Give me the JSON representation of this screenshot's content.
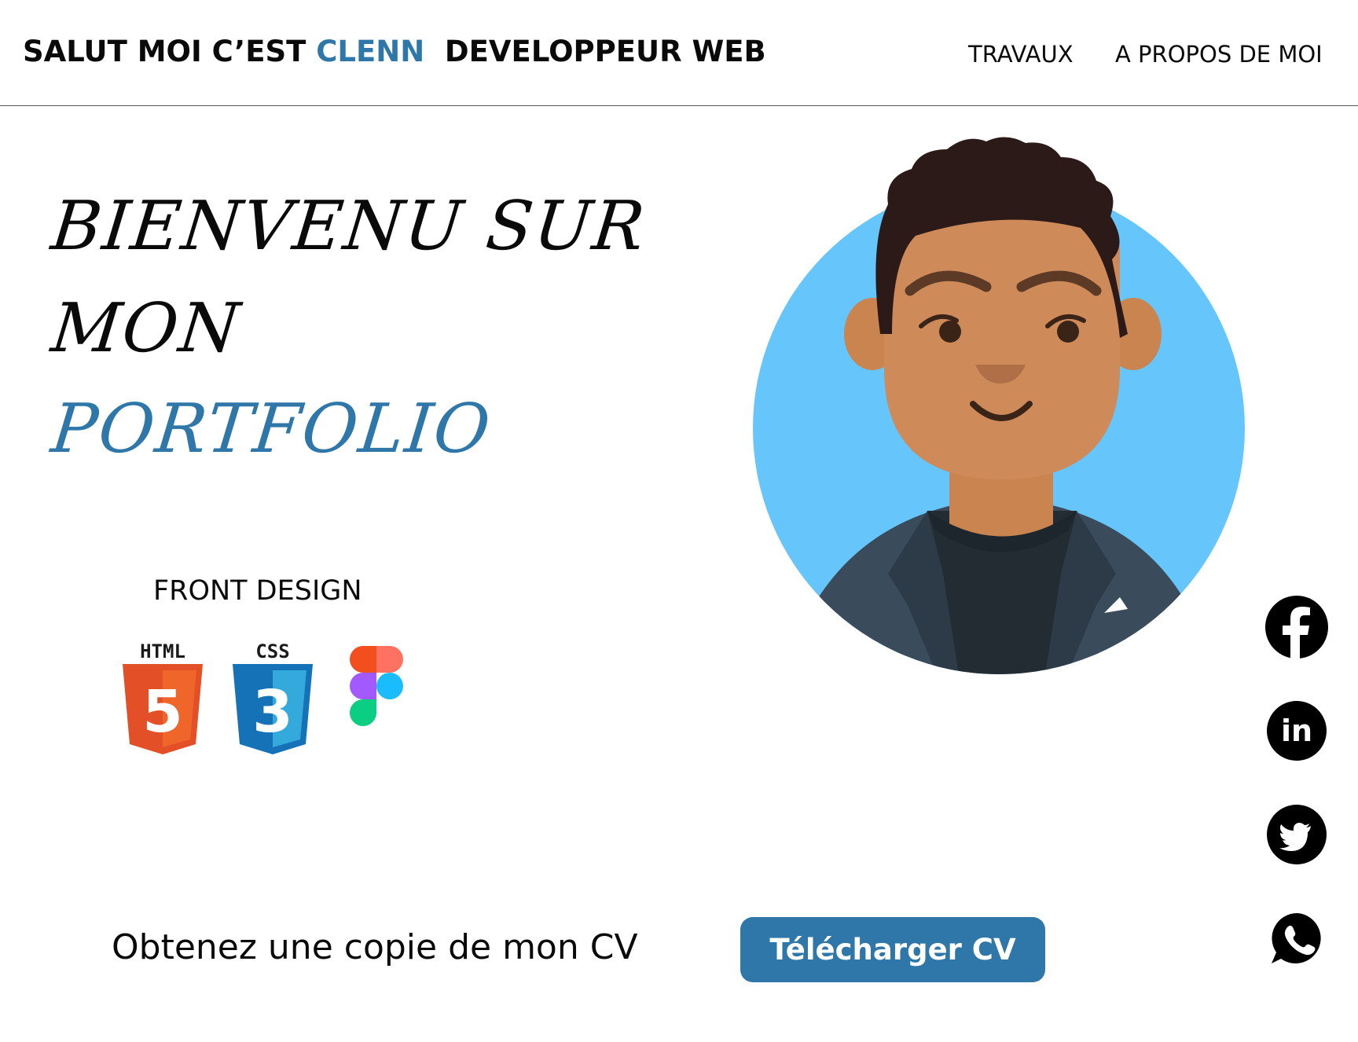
{
  "header": {
    "brand_prefix": "SALUT MOI C’EST ",
    "brand_name": "CLENN",
    "brand_suffix": "  DEVELOPPEUR WEB",
    "nav": {
      "work": "TRAVAUX",
      "about": "A PROPOS DE MOI"
    }
  },
  "hero": {
    "line1": "BIENVENU SUR",
    "line2": "MON",
    "line3": "PORTFOLIO"
  },
  "skills": {
    "title": "FRONT DESIGN",
    "tools": [
      {
        "label": "HTML",
        "digit": "5",
        "icon": "html5-icon"
      },
      {
        "label": "CSS",
        "digit": "3",
        "icon": "css3-icon"
      },
      {
        "icon": "figma-icon"
      }
    ]
  },
  "social": [
    "facebook-icon",
    "linkedin-icon",
    "twitter-icon",
    "whatsapp-icon"
  ],
  "linkedin_text": "in",
  "cv": {
    "text": "Obtenez une copie de mon CV",
    "button": "Télécharger CV"
  },
  "colors": {
    "accent": "#2f77a8",
    "avatar_bg": "#66c6fb",
    "skin": "#cf8a5a",
    "hair": "#2b1a17",
    "jacket": "#3a4b5b"
  }
}
